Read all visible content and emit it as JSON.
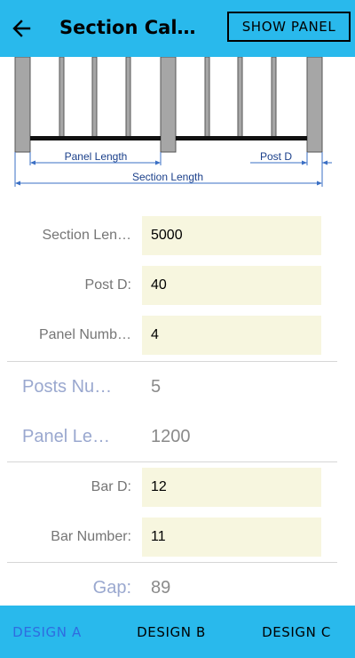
{
  "appbar": {
    "title": "Section Cal…",
    "show_panel_label": "SHOW PANEL"
  },
  "diagram": {
    "panel_length_label": "Panel Length",
    "post_d_label": "Post D",
    "section_length_label": "Section Length"
  },
  "inputs": {
    "section_length": {
      "label": "Section Len…",
      "value": "5000"
    },
    "post_d": {
      "label": "Post D:",
      "value": "40"
    },
    "panel_number": {
      "label": "Panel Numb…",
      "value": "4"
    },
    "bar_d": {
      "label": "Bar D:",
      "value": "12"
    },
    "bar_number": {
      "label": "Bar Number:",
      "value": "11"
    }
  },
  "outputs": {
    "posts_number": {
      "label": "Posts Nu…",
      "value": "5"
    },
    "panel_length": {
      "label": "Panel Le…",
      "value": "1200"
    },
    "gap": {
      "label": "Gap:",
      "value": "89"
    }
  },
  "bottom_nav": {
    "tabs": [
      {
        "label": "DESIGN A",
        "active": true
      },
      {
        "label": "DESIGN B",
        "active": false
      },
      {
        "label": "DESIGN C",
        "active": false
      }
    ]
  },
  "colors": {
    "accent": "#29b9ec",
    "input_bg": "#f7f6df",
    "active_tab": "#2f6ce0"
  }
}
